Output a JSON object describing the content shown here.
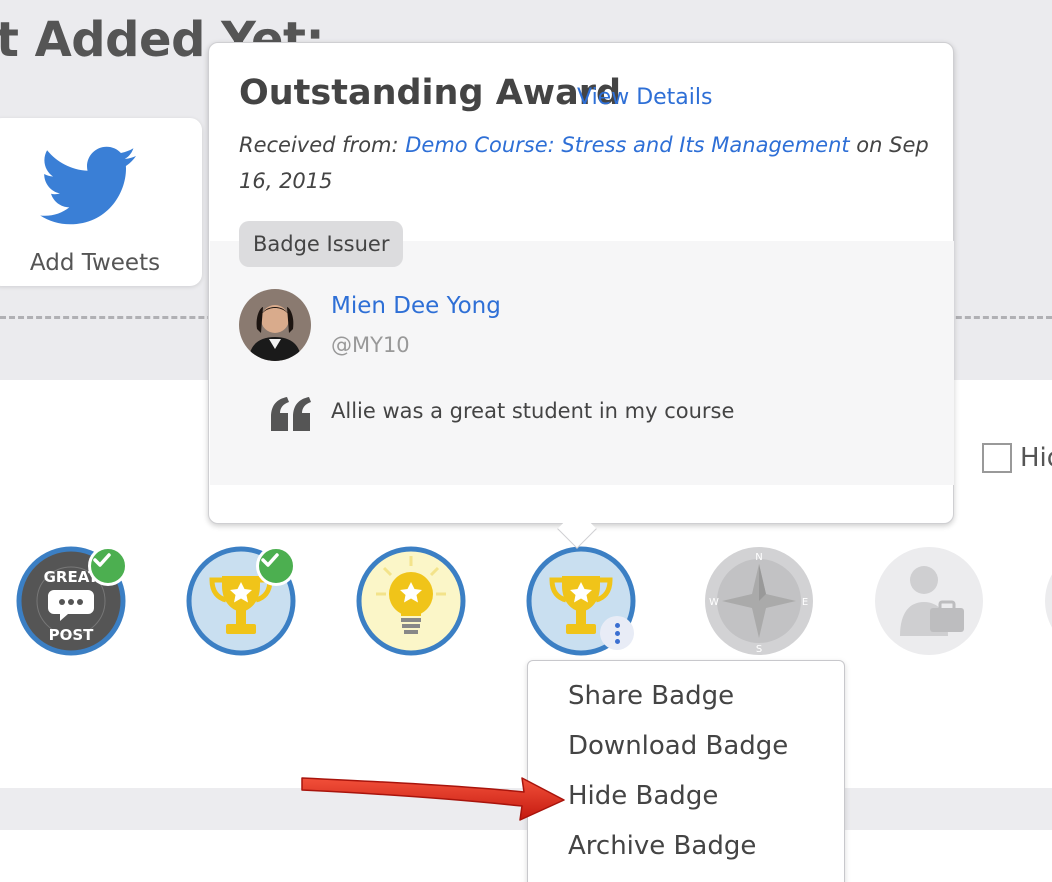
{
  "header": {
    "title": "t Added Yet:"
  },
  "tweet_card": {
    "label": "Add Tweets",
    "icon": "twitter-bird-icon"
  },
  "hide_checkbox": {
    "label": "Hid",
    "checked": false
  },
  "popover": {
    "title": "Outstanding Award",
    "view_details": "View Details",
    "received_prefix": "Received from: ",
    "course_link": "Demo Course: Stress and Its Management",
    "received_suffix": " on Sep 16, 2015",
    "issuer_chip": "Badge Issuer",
    "issuer_name": "Mien Dee Yong",
    "issuer_handle": "@MY10",
    "quote": "Allie was a great student in my course"
  },
  "badges": [
    {
      "name": "great-post-badge",
      "text": "GREAT POST",
      "status": "accepted"
    },
    {
      "name": "trophy-badge",
      "status": "accepted"
    },
    {
      "name": "lightbulb-badge",
      "status": "new"
    },
    {
      "name": "outstanding-award-badge",
      "status": "selected"
    },
    {
      "name": "compass-badge",
      "status": "locked"
    },
    {
      "name": "professional-badge",
      "status": "locked"
    }
  ],
  "menu": {
    "items": [
      "Share Badge",
      "Download Badge",
      "Hide Badge",
      "Archive Badge"
    ]
  },
  "colors": {
    "accent": "#2e6fd6",
    "success": "#4caf50",
    "badge_ring": "#3b7fc4",
    "arrow": "#e0281e"
  }
}
